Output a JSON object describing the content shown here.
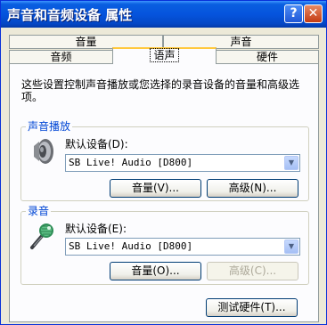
{
  "window": {
    "title": "声音和音频设备 属性"
  },
  "titlebar": {
    "help": "?",
    "close": "✕"
  },
  "tabs": {
    "row1": [
      {
        "label": "音量"
      },
      {
        "label": "声音"
      }
    ],
    "row2": [
      {
        "label": "音频"
      },
      {
        "label": "语声",
        "active": true
      },
      {
        "label": "硬件"
      }
    ]
  },
  "description": "这些设置控制声音播放或您选择的录音设备的音量和高级选项。",
  "playback": {
    "group_title": "声音播放",
    "icon": "speaker-icon",
    "device_label": "默认设备(D):",
    "device_value": "SB Live! Audio [D800]",
    "volume_button": "音量(V)...",
    "advanced_button": "高级(N)..."
  },
  "recording": {
    "group_title": "录音",
    "icon": "microphone-icon",
    "device_label": "默认设备(E):",
    "device_value": "SB Live! Audio [D800]",
    "volume_button": "音量(O)...",
    "advanced_button": "高级(C)...",
    "advanced_disabled": true
  },
  "test_button": "测试硬件(T)...",
  "colors": {
    "title_bar": "#0554dd",
    "accent_tab": "#ffc83c",
    "group_title": "#0046d5"
  }
}
